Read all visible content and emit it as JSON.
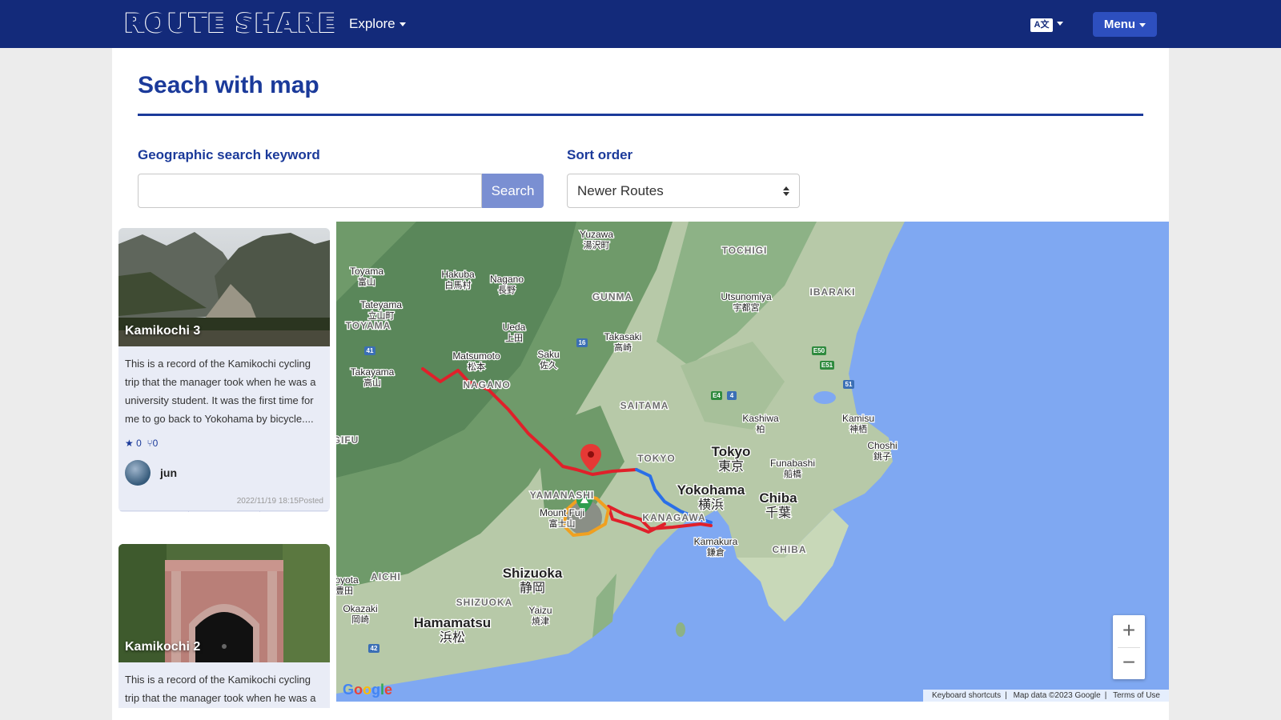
{
  "nav": {
    "brand": "ROUTE SHARE",
    "explore": "Explore",
    "lang_icon": "A文",
    "menu": "Menu"
  },
  "page": {
    "title": "Seach with map"
  },
  "search": {
    "keyword_label": "Geographic search keyword",
    "placeholder": "",
    "button": "Search",
    "sort_label": "Sort order",
    "sort_value": "Newer Routes"
  },
  "cards": [
    {
      "title": "Kamikochi 3",
      "description": "This is a record of the Kamikochi cycling trip that the manager took when he was a university student. It was the first time for me to go back to Yokohama by bicycle....",
      "stars": "0",
      "forks": "0",
      "user": "jun",
      "posted": "2022/11/19 18:15Posted",
      "actions": [
        "star-icon",
        "download-icon",
        "more-icon"
      ]
    },
    {
      "title": "Kamikochi 2",
      "description": "This is a record of the Kamikochi cycling trip that the manager took when he was a"
    }
  ],
  "map": {
    "labels": [
      {
        "name": "Yuzawa",
        "jp": "湯沢町"
      },
      {
        "name": "TOCHIGI",
        "jp": ""
      },
      {
        "name": "Toyama",
        "jp": "富山"
      },
      {
        "name": "Hakuba",
        "jp": "白馬村"
      },
      {
        "name": "Nagano",
        "jp": "長野"
      },
      {
        "name": "GUNMA",
        "jp": ""
      },
      {
        "name": "Utsunomiya",
        "jp": "宇都宮"
      },
      {
        "name": "IBARAKI",
        "jp": ""
      },
      {
        "name": "Tateyama",
        "jp": "立山町"
      },
      {
        "name": "TOYAMA",
        "jp": ""
      },
      {
        "name": "Ueda",
        "jp": "上田"
      },
      {
        "name": "Takasaki",
        "jp": "高崎"
      },
      {
        "name": "Matsumoto",
        "jp": "松本"
      },
      {
        "name": "Saku",
        "jp": "佐久"
      },
      {
        "name": "Takayama",
        "jp": "高山"
      },
      {
        "name": "NAGANO",
        "jp": ""
      },
      {
        "name": "SAITAMA",
        "jp": ""
      },
      {
        "name": "Kashiwa",
        "jp": "柏"
      },
      {
        "name": "Kamisu",
        "jp": "神栖"
      },
      {
        "name": "GIFU",
        "jp": ""
      },
      {
        "name": "Choshi",
        "jp": "銚子"
      },
      {
        "name": "TOKYO",
        "jp": ""
      },
      {
        "name": "Tokyo",
        "jp": "東京"
      },
      {
        "name": "Funabashi",
        "jp": "船橋"
      },
      {
        "name": "YAMANASHI",
        "jp": ""
      },
      {
        "name": "Yokohama",
        "jp": "横浜"
      },
      {
        "name": "Chiba",
        "jp": "千葉"
      },
      {
        "name": "Mount Fuji",
        "jp": "富士山"
      },
      {
        "name": "KANAGAWA",
        "jp": ""
      },
      {
        "name": "Kamakura",
        "jp": "鎌倉"
      },
      {
        "name": "CHIBA",
        "jp": ""
      },
      {
        "name": "AICHI",
        "jp": ""
      },
      {
        "name": "Shizuoka",
        "jp": "静岡"
      },
      {
        "name": "Toyota",
        "jp": "豊田"
      },
      {
        "name": "SHIZUOKA",
        "jp": ""
      },
      {
        "name": "Okazaki",
        "jp": "岡崎"
      },
      {
        "name": "Hamamatsu",
        "jp": "浜松"
      },
      {
        "name": "Yaizu",
        "jp": "焼津"
      }
    ],
    "highway_shields": [
      "41",
      "16",
      "E50",
      "E51",
      "E4",
      "4",
      "51",
      "42"
    ],
    "zoom_in": "+",
    "zoom_out": "−",
    "google": "Google",
    "attribution": [
      "Keyboard shortcuts",
      "Map data ©2023 Google",
      "Terms of Use"
    ],
    "route_colors": {
      "red": "#e0202a",
      "blue": "#2a6fe8",
      "orange": "#f0a020"
    },
    "marker_colors": {
      "pin": "#e53935",
      "peak": "#2e9e4f"
    }
  }
}
